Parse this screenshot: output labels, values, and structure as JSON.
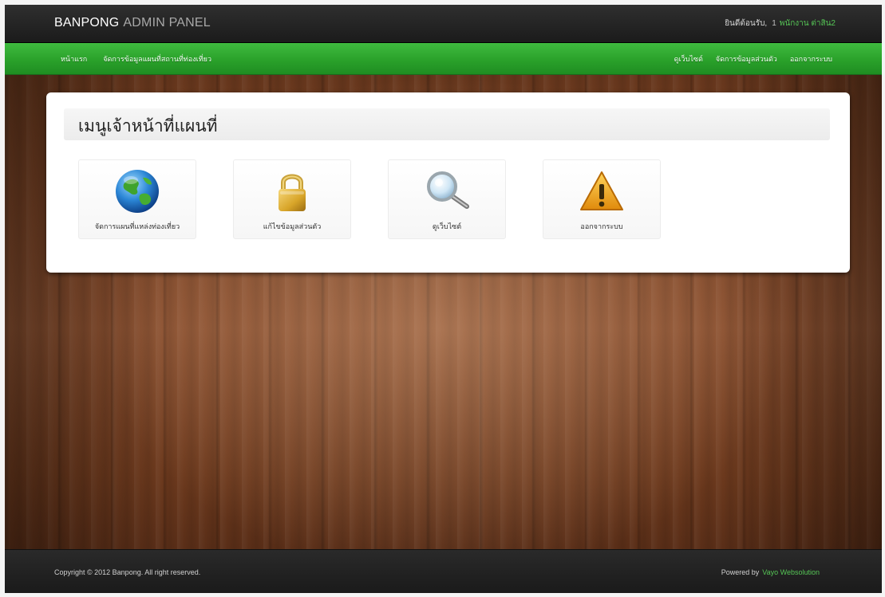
{
  "header": {
    "brand_primary": "BANPONG",
    "brand_secondary": "ADMIN PANEL",
    "welcome_label": "ยินดีต้อนรับ,",
    "welcome_count": "1",
    "username": "พนักงาน ต่าสิน2"
  },
  "nav": {
    "left": [
      {
        "label": "หน้าแรก"
      },
      {
        "label": "จัดการข้อมูลแผนที่สถานที่ท่องเที่ยว"
      }
    ],
    "right": [
      {
        "label": "ดูเว็บไซต์"
      },
      {
        "label": "จัดการข้อมูลส่วนตัว"
      },
      {
        "label": "ออกจากระบบ"
      }
    ]
  },
  "panel": {
    "title": "เมนูเจ้าหน้าที่แผนที่",
    "tiles": [
      {
        "label": "จัดการแผนที่แหล่งท่องเที่ยว",
        "icon": "globe-icon"
      },
      {
        "label": "แก้ไขข้อมูลส่วนตัว",
        "icon": "padlock-icon"
      },
      {
        "label": "ดูเว็บไซต์",
        "icon": "magnifier-icon"
      },
      {
        "label": "ออกจากระบบ",
        "icon": "warning-icon"
      }
    ]
  },
  "footer": {
    "copyright": "Copyright © 2012 Banpong. All right reserved.",
    "powered_label": "Powered by",
    "powered_vendor": "Vayo Websolution"
  },
  "colors": {
    "topbar": "#1f1f1f",
    "nav_green": "#2aa12a",
    "accent_green": "#55c455",
    "panel_bg": "#ffffff"
  }
}
